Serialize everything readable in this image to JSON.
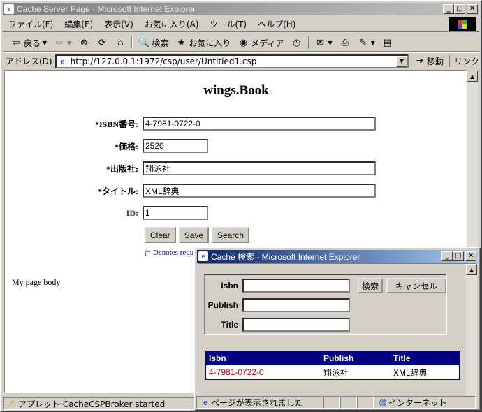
{
  "main_window": {
    "title": "Cache Server Page - Microsoft Internet Explorer",
    "menu": [
      "ファイル(F)",
      "編集(E)",
      "表示(V)",
      "お気に入り(A)",
      "ツール(T)",
      "ヘルプ(H)"
    ],
    "toolbar": {
      "back": "戻る",
      "search": "検索",
      "favorites": "お気に入り",
      "media": "メディア"
    },
    "address_label": "アドレス(D)",
    "url": "http://127.0.0.1:1972/csp/user/Untitled1.csp",
    "go": "移動",
    "links": "リンク",
    "status": "アプレット CacheCSPBroker started"
  },
  "page": {
    "title": "wings.Book",
    "fields": [
      {
        "label": "*ISBN番号:",
        "value": "4-7981-0722-0",
        "required": true
      },
      {
        "label": "*価格:",
        "value": "2520",
        "required": true
      },
      {
        "label": "*出版社:",
        "value": "翔泳社",
        "required": true
      },
      {
        "label": "*タイトル:",
        "value": "XML辞典",
        "required": true
      },
      {
        "label": "ID:",
        "value": "1",
        "required": false
      }
    ],
    "buttons": {
      "clear": "Clear",
      "save": "Save",
      "search": "Search"
    },
    "note": "(* Denotes requ",
    "body_text": "My page body"
  },
  "popup": {
    "title": "Caché 検索 - Microsoft Internet Explorer",
    "labels": {
      "isbn": "Isbn",
      "publish": "Publish",
      "title": "Title"
    },
    "search_button": "検索",
    "cancel_button": "キャンセル",
    "results": {
      "headers": [
        "Isbn",
        "Publish",
        "Title"
      ],
      "rows": [
        [
          "4-7981-0722-0",
          "翔泳社",
          "XML辞典"
        ]
      ]
    },
    "status": "ページが表示されました",
    "zone": "インターネット"
  },
  "colors": {
    "active_title": "#0a246a",
    "result_header": "#000080",
    "isbn_link": "#c00000"
  }
}
